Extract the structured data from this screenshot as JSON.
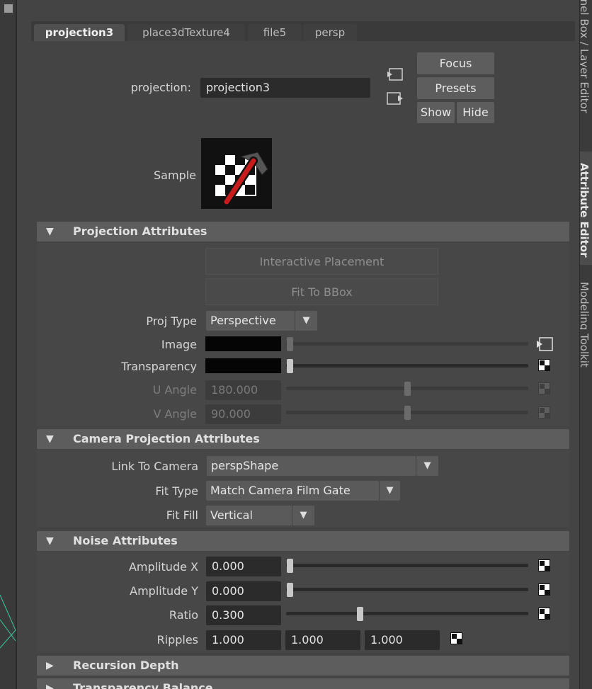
{
  "node_tabs": [
    "projection3",
    "place3dTexture4",
    "file5",
    "persp"
  ],
  "active_tab": "projection3",
  "side_tabs": [
    "Channel Box / Layer Editor",
    "Attribute Editor",
    "Modeling Toolkit"
  ],
  "header": {
    "projection_label": "projection:",
    "projection_value": "projection3",
    "focus_label": "Focus",
    "presets_label": "Presets",
    "show_label": "Show",
    "hide_label": "Hide",
    "sample_label": "Sample"
  },
  "projection_attributes": {
    "section_title": "Projection Attributes",
    "interactive_placement_label": "Interactive Placement",
    "fit_to_bbox_label": "Fit To BBox",
    "proj_type_label": "Proj Type",
    "proj_type_value": "Perspective",
    "image_label": "Image",
    "transparency_label": "Transparency",
    "u_angle_label": "U Angle",
    "u_angle_value": "180.000",
    "v_angle_label": "V Angle",
    "v_angle_value": "90.000"
  },
  "camera_projection_attributes": {
    "section_title": "Camera Projection Attributes",
    "link_to_camera_label": "Link To Camera",
    "link_to_camera_value": "perspShape",
    "fit_type_label": "Fit Type",
    "fit_type_value": "Match Camera Film Gate",
    "fit_fill_label": "Fit Fill",
    "fit_fill_value": "Vertical"
  },
  "noise_attributes": {
    "section_title": "Noise Attributes",
    "amplitude_x_label": "Amplitude X",
    "amplitude_x_value": "0.000",
    "amplitude_y_label": "Amplitude Y",
    "amplitude_y_value": "0.000",
    "ratio_label": "Ratio",
    "ratio_value": "0.300",
    "ripples_label": "Ripples",
    "ripples_values": [
      "1.000",
      "1.000",
      "1.000"
    ]
  },
  "collapsed_sections": [
    "Recursion Depth",
    "Transparency Balance"
  ],
  "slider_levels": {
    "image": 0.0,
    "transparency": 0.0,
    "u_angle": 0.5,
    "v_angle": 0.5,
    "amplitude_x": 0.0,
    "amplitude_y": 0.0,
    "ratio": 0.3
  },
  "colors": {
    "background": "#444444",
    "section_header": "#5d5d5d",
    "field": "#2b2b2b",
    "swatch_image": "#050505",
    "swatch_transparency": "#050505"
  }
}
